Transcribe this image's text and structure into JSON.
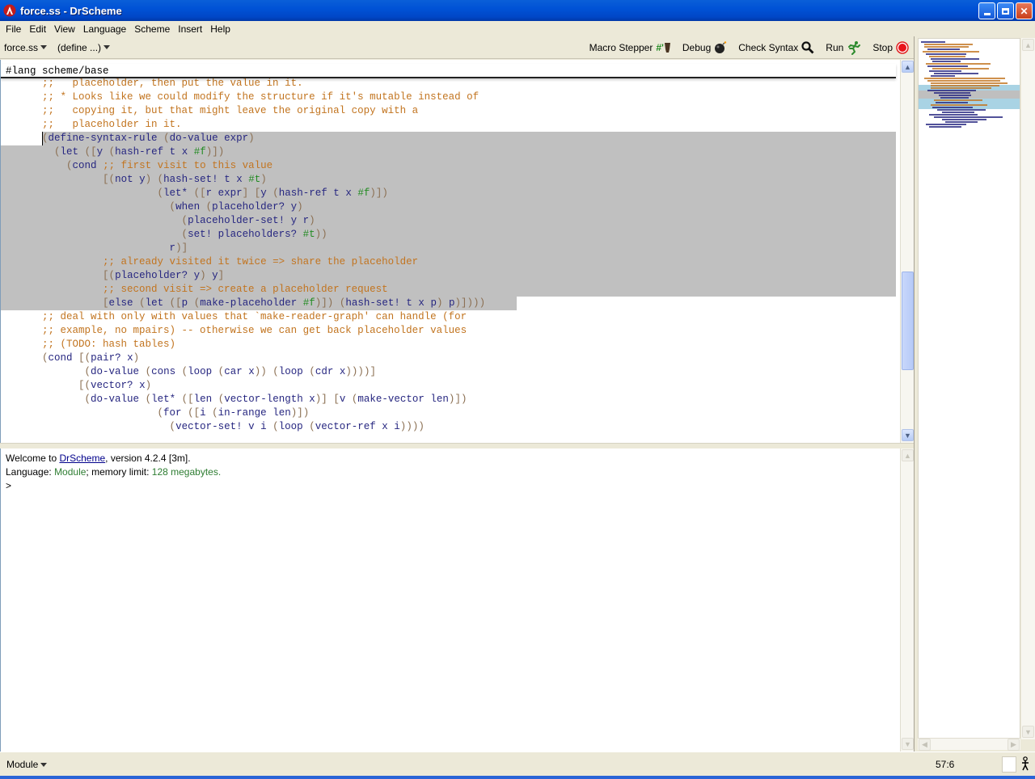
{
  "window": {
    "title": "force.ss - DrScheme",
    "buttons": [
      "minimize",
      "restore",
      "close"
    ]
  },
  "menubar": {
    "items": [
      {
        "label": "File",
        "mnemonic": "F"
      },
      {
        "label": "Edit",
        "mnemonic": "E"
      },
      {
        "label": "View",
        "mnemonic": "V"
      },
      {
        "label": "Language",
        "mnemonic": "L"
      },
      {
        "label": "Scheme",
        "mnemonic": "c"
      },
      {
        "label": "Insert",
        "mnemonic": "I"
      },
      {
        "label": "Help",
        "mnemonic": "H"
      }
    ]
  },
  "toolbar": {
    "file_menu": "force.ss",
    "define_menu": "(define ...)",
    "macro_stepper": "Macro Stepper",
    "macro_stepper_icon": "#'",
    "debug": "Debug",
    "check_syntax": "Check Syntax",
    "run": "Run",
    "stop": "Stop"
  },
  "editor": {
    "lang_line": "#lang scheme/base",
    "lines": [
      {
        "text": "      ;;   placeholder, then put the value in it.",
        "selected": false
      },
      {
        "text": "      ;; * Looks like we could modify the structure if it's mutable instead of",
        "selected": false
      },
      {
        "text": "      ;;   copying it, but that might leave the original copy with a",
        "selected": false
      },
      {
        "text": "      ;;   placeholder in it.",
        "selected": false
      },
      {
        "text": "      (define-syntax-rule (do-value expr)",
        "selected": true
      },
      {
        "text": "        (let ([y (hash-ref t x #f)])",
        "selected": true
      },
      {
        "text": "          (cond ;; first visit to this value",
        "selected": true
      },
      {
        "text": "                [(not y) (hash-set! t x #t)",
        "selected": true
      },
      {
        "text": "                         (let* ([r expr] [y (hash-ref t x #f)])",
        "selected": true
      },
      {
        "text": "                           (when (placeholder? y)",
        "selected": true
      },
      {
        "text": "                             (placeholder-set! y r)",
        "selected": true
      },
      {
        "text": "                             (set! placeholders? #t))",
        "selected": true
      },
      {
        "text": "                           r)]",
        "selected": true
      },
      {
        "text": "                ;; already visited it twice => share the placeholder",
        "selected": true
      },
      {
        "text": "                [(placeholder? y) y]",
        "selected": true
      },
      {
        "text": "                ;; second visit => create a placeholder request",
        "selected": true
      },
      {
        "text": "                [else (let ([p (make-placeholder #f)]) (hash-set! t x p) p)])))",
        "selected": true
      },
      {
        "text": "      ;; deal with only with values that `make-reader-graph' can handle (for",
        "selected": false
      },
      {
        "text": "      ;; example, no mpairs) -- otherwise we can get back placeholder values",
        "selected": false
      },
      {
        "text": "      ;; (TODO: hash tables)",
        "selected": false
      },
      {
        "text": "      (cond [(pair? x)",
        "selected": false
      },
      {
        "text": "             (do-value (cons (loop (car x)) (loop (cdr x))))]",
        "selected": false
      },
      {
        "text": "            [(vector? x)",
        "selected": false
      },
      {
        "text": "             (do-value (let* ([len (vector-length x)] [v (make-vector len)])",
        "selected": false
      },
      {
        "text": "                         (for ([i (in-range len)])",
        "selected": false
      },
      {
        "text": "                           (vector-set! v i (loop (vector-ref x i))))",
        "selected": false
      }
    ]
  },
  "repl": {
    "welcome_prefix": "Welcome to ",
    "welcome_link": "DrScheme",
    "welcome_suffix": ", version 4.2.4 [3m].",
    "language_prefix": "Language: ",
    "language_name": "Module",
    "memory_prefix": "; memory limit: ",
    "memory_value": "128 megabytes.",
    "prompt": ">"
  },
  "statusbar": {
    "language": "Module",
    "position": "57:6"
  },
  "colors": {
    "comment": "#c2741f",
    "keyword": "#262680",
    "constant": "#228b22",
    "selection": "#c0c0c0",
    "titlebar": "#0052d6"
  }
}
